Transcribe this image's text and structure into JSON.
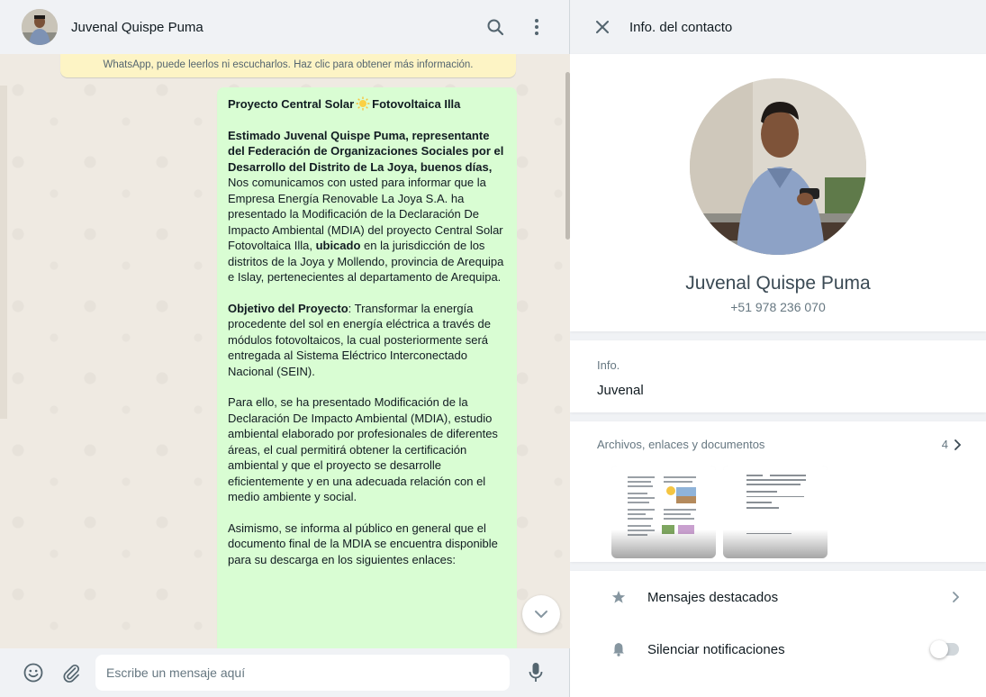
{
  "chat": {
    "contact_name": "Juvenal Quispe Puma",
    "security_notice": "WhatsApp, puede leerlos ni escucharlos. Haz clic para obtener más información.",
    "message": {
      "title_part1": "Proyecto Central Solar",
      "title_part2": "Fotovoltaica Illa",
      "greeting": "Estimado Juvenal Quispe Puma, representante del Federación de Organizaciones Sociales por el Desarrollo del Distrito de La Joya, buenos días,",
      "intro_part1": "Nos comunicamos con usted para informar que la Empresa Energía Renovable La Joya S.A. ha presentado la Modificación de la Declaración De Impacto Ambiental (MDIA) del proyecto Central Solar Fotovoltaica Illa,",
      "intro_bold": "ubicado",
      "intro_part2": "en la jurisdicción de los distritos de la Joya y Mollendo, provincia de Arequipa e Islay, pertenecientes al departamento de Arequipa.",
      "objective_label": "Objetivo del Proyecto",
      "objective_text": ": Transformar la energía procedente del sol en energía eléctrica a través de módulos fotovoltaicos, la cual posteriormente será entregada al Sistema Eléctrico Interconectado Nacional (SEIN).",
      "paragraph3": "Para ello, se ha presentado Modificación de la Declaración De Impacto Ambiental (MDIA), estudio ambiental elaborado por profesionales de diferentes áreas, el cual permitirá obtener la certificación ambiental y que el proyecto se desarrolle eficientemente y en una adecuada relación con el medio ambiente y social.",
      "paragraph4": "Asimismo, se informa al público en general que el documento final de la MDIA se encuentra disponible para su descarga en los siguientes enlaces:"
    },
    "composer": {
      "placeholder": "Escribe un mensaje aquí"
    }
  },
  "contact_info": {
    "header_title": "Info. del contacto",
    "name": "Juvenal Quispe Puma",
    "phone": "+51 978 236 070",
    "about_label": "Info.",
    "about_value": "Juvenal",
    "media_label": "Archivos, enlaces y documentos",
    "media_count": "4",
    "options": [
      {
        "label": "Mensajes destacados",
        "icon": "star-icon"
      },
      {
        "label": "Silenciar notificaciones",
        "icon": "bell-icon"
      }
    ],
    "mute_enabled": false
  },
  "colors": {
    "bubble_out": "#d9fdd3",
    "panel_bg": "#f0f2f5",
    "notice_bg": "#fdf4c5"
  }
}
